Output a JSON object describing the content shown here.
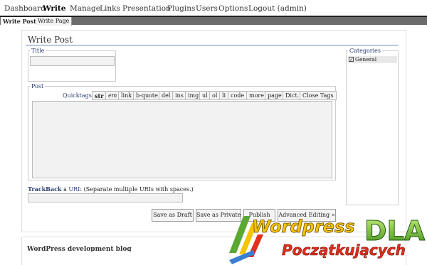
{
  "nav": {
    "items": [
      "Dashboard",
      "Write",
      "Manage",
      "Links",
      "Presentation",
      "Plugins",
      "Users",
      "Options",
      "Logout (admin)"
    ],
    "active": "Write"
  },
  "subnav": {
    "items": [
      "Write Post",
      "Write Page"
    ],
    "active": "Write Post"
  },
  "page": {
    "title": "Write Post",
    "title_legend": "Title",
    "title_value": "",
    "post_legend": "Post",
    "quicktags_label": "Quicktags:",
    "quicktags": [
      "str",
      "em",
      "link",
      "b-quote",
      "del",
      "ins",
      "img",
      "ul",
      "ol",
      "li",
      "code",
      "more",
      "page",
      "Dict.",
      "Close Tags"
    ],
    "post_body": "",
    "categories_legend": "Categories",
    "categories": [
      {
        "label": "General",
        "checked": true
      }
    ],
    "trackback_prefix": "TrackBack",
    "trackback_a": " a ",
    "trackback_uri": "URI",
    "trackback_note": ": (Separate multiple URIs with spaces.)",
    "trackback_value": "",
    "buttons": {
      "draft": "Save as Draft",
      "private": "Save as Private",
      "publish": "Publish",
      "advanced": "Advanced Editing »"
    }
  },
  "bottom": {
    "text": "WordPress development blog"
  },
  "logo": {
    "line1": "Wordpress",
    "line2": "DLA",
    "line3": "Początkujących"
  },
  "colors": {
    "nav_rule": "#222222",
    "subnav_bg": "#6b6b6b",
    "link": "#2a3e73",
    "logo_green": "#5aa832",
    "logo_yellow": "#f5c400",
    "logo_red": "#e0301e"
  }
}
